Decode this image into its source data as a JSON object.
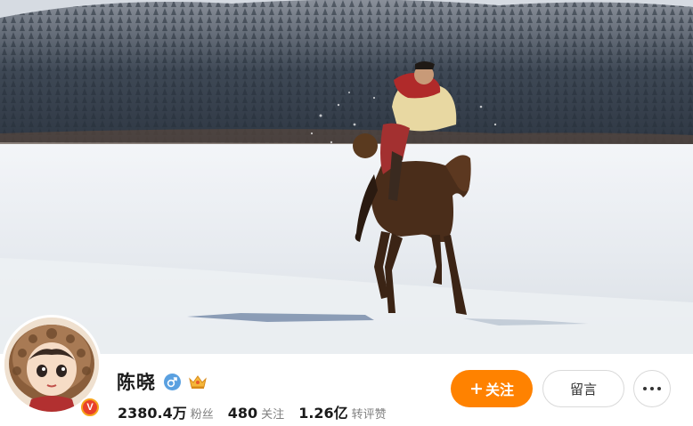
{
  "profile": {
    "name": "陈晓",
    "gender_icon": "male-icon",
    "member_icon": "crown-icon",
    "verified_icon": "v-badge-icon",
    "stats": [
      {
        "value": "2380.4万",
        "label": "粉丝"
      },
      {
        "value": "480",
        "label": "关注"
      },
      {
        "value": "1.26亿",
        "label": "转评赞"
      }
    ]
  },
  "actions": {
    "follow_plus": "+",
    "follow_label": "关注",
    "message_label": "留言",
    "more_icon": "more-dots-icon"
  },
  "colors": {
    "accent": "#ff8200",
    "gender_male": "#5aa0e0",
    "verified": "#e8402a"
  }
}
